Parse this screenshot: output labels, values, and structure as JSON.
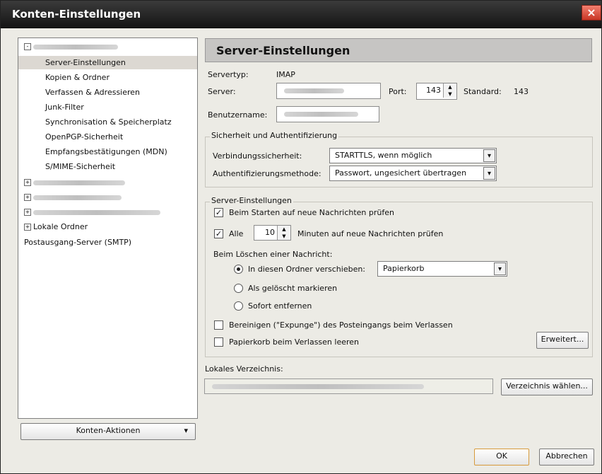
{
  "window": {
    "title": "Konten-Einstellungen",
    "close_glyph": "×"
  },
  "tree": {
    "items": [
      {
        "label": "Server-Einstellungen",
        "selected": true
      },
      {
        "label": "Kopien & Ordner"
      },
      {
        "label": "Verfassen & Adressieren"
      },
      {
        "label": "Junk-Filter"
      },
      {
        "label": "Synchronisation & Speicherplatz"
      },
      {
        "label": "OpenPGP-Sicherheit"
      },
      {
        "label": "Empfangsbestätigungen (MDN)"
      },
      {
        "label": "S/MIME-Sicherheit"
      }
    ],
    "local_folders": "Lokale Ordner",
    "smtp": "Postausgang-Server (SMTP)",
    "expander_plus": "+",
    "expander_minus": "-"
  },
  "sidebar": {
    "account_actions": "Konten-Aktionen",
    "account_actions_arrow": "▾"
  },
  "page": {
    "title": "Server-Einstellungen"
  },
  "server": {
    "type_label": "Servertyp:",
    "type_value": "IMAP",
    "server_label": "Server:",
    "port_label": "Port:",
    "port_value": "143",
    "standard_label": "Standard:",
    "standard_value": "143",
    "username_label": "Benutzername:"
  },
  "security": {
    "legend": "Sicherheit und Authentifizierung",
    "connection_label": "Verbindungssicherheit:",
    "connection_value": "STARTTLS, wenn möglich",
    "auth_label": "Authentifizierungsmethode:",
    "auth_value": "Passwort, ungesichert übertragen"
  },
  "settings": {
    "legend": "Server-Einstellungen",
    "check_on_start": "Beim Starten auf neue Nachrichten prüfen",
    "every_label": "Alle",
    "every_value": "10",
    "minutes_label": "Minuten auf neue Nachrichten prüfen",
    "delete_label": "Beim Löschen einer Nachricht:",
    "move_to_folder": "In diesen Ordner verschieben:",
    "folder_value": "Papierkorb",
    "mark_deleted": "Als gelöscht markieren",
    "remove_immediately": "Sofort entfernen",
    "expunge_on_exit": "Bereinigen (\"Expunge\") des Posteingangs beim Verlassen",
    "empty_trash_on_exit": "Papierkorb beim Verlassen leeren",
    "advanced": "Erweitert..."
  },
  "local": {
    "label": "Lokales Verzeichnis:",
    "choose": "Verzeichnis wählen..."
  },
  "footer": {
    "ok": "OK",
    "cancel": "Abbrechen"
  },
  "icons": {
    "check": "✓",
    "arrow_down": "▾",
    "spin_up": "▲",
    "spin_down": "▼"
  }
}
